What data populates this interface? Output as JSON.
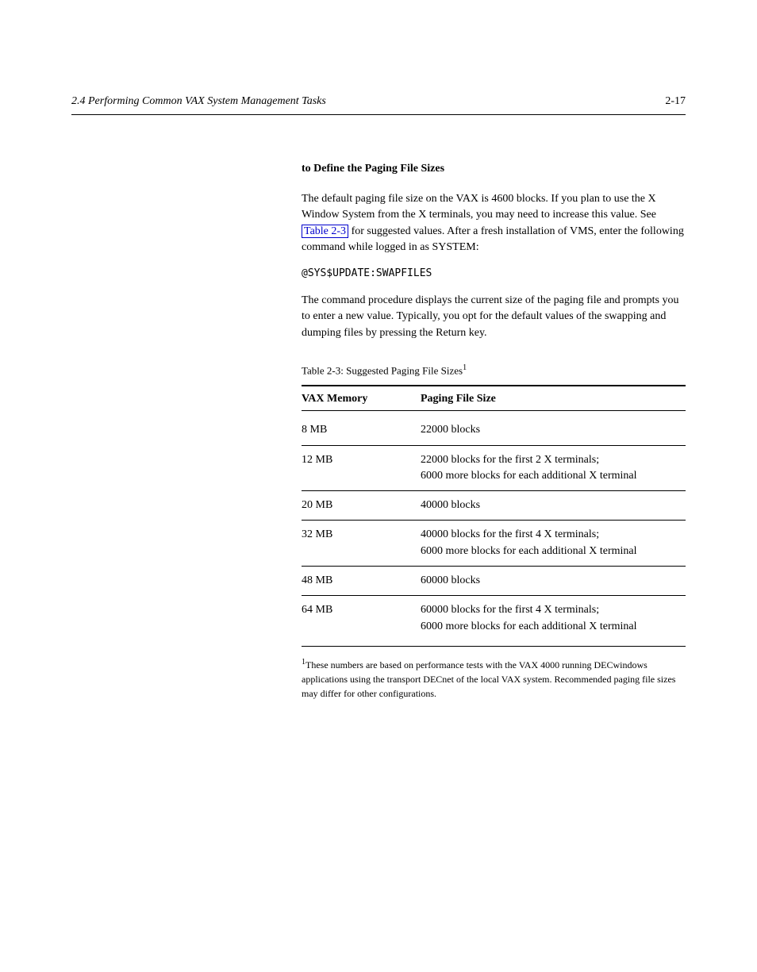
{
  "header": {
    "section": "2.4    Performing Common VAX System Management Tasks",
    "pageNumber": "2-17"
  },
  "subsection": {
    "titleBold": "to Define the Paging File Sizes",
    "par1_before_link": "The default paging file size on the VAX is 4600 blocks. If you plan to use the X Window System from the X terminals, you may need to increase this value. See ",
    "par1_link": "Table 2-3",
    "par1_after_link": " for suggested values. After a fresh installation of VMS, enter the following command while logged in as SYSTEM:",
    "command": "@SYS$UPDATE:SWAPFILES",
    "par2": "The command procedure displays the current size of the paging file and prompts you to enter a new value. Typically, you opt for the default values of the swapping and dumping files by pressing the Return key."
  },
  "table": {
    "caption": "Table 2-3: Suggested Paging File Sizes",
    "headers": [
      "VAX Memory",
      "Paging File Size"
    ],
    "rows": [
      {
        "left": "8 MB",
        "right": "22000 blocks"
      },
      {
        "left": "12 MB",
        "right": "22000 blocks for the first 2 X terminals;\n6000 more blocks for each additional X terminal"
      },
      {
        "left": "20 MB",
        "right": "40000 blocks"
      },
      {
        "left": "32 MB",
        "right": "40000 blocks for the first 4 X terminals;\n6000 more blocks for each additional X terminal"
      },
      {
        "left": "48 MB",
        "right": "60000 blocks"
      },
      {
        "left": "64 MB",
        "right": "60000 blocks for the first 4 X terminals;\n6000 more blocks for each additional X terminal"
      }
    ],
    "footnote_sup": "1",
    "footnote_text": "These numbers are based on performance tests with the VAX 4000 running DECwindows applications using the transport DECnet of the local VAX system. Recommended paging file sizes may differ for other configurations."
  }
}
